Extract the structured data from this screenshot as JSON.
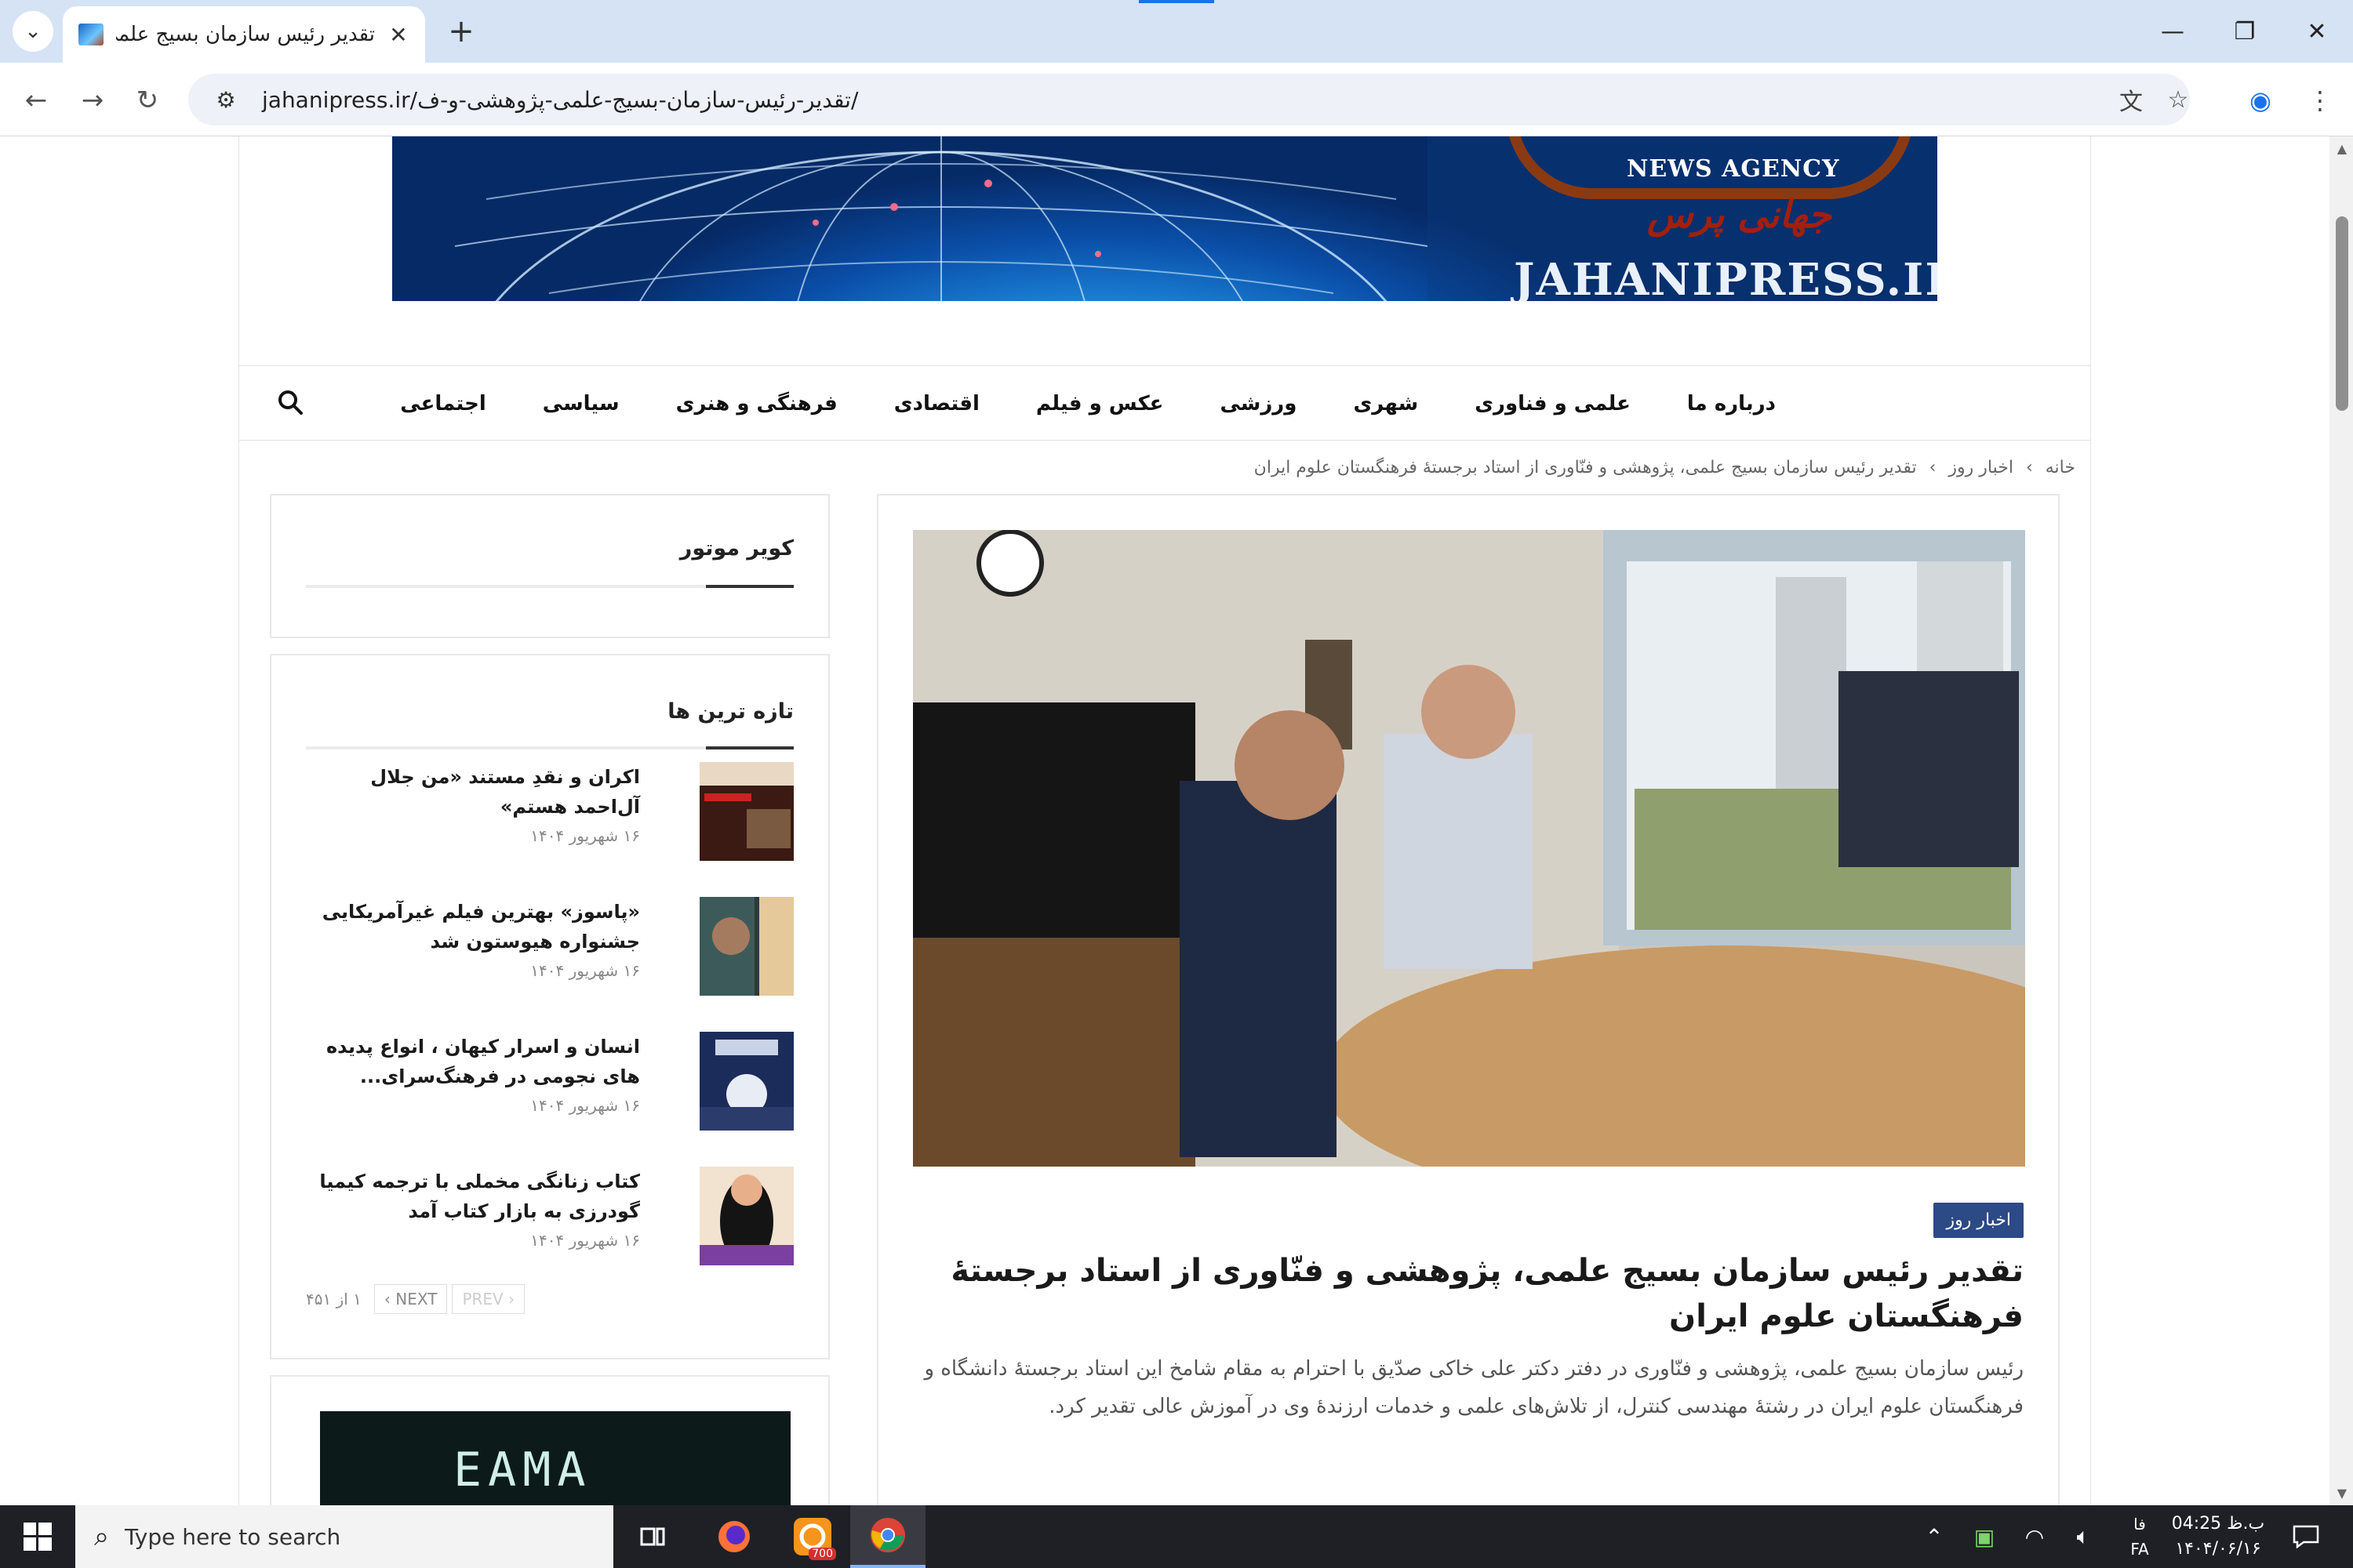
{
  "browser": {
    "tab_title": "تقدیر رئیس سازمان بسیج علمی، پ",
    "new_tab_label": "+",
    "tab_close_label": "✕",
    "url": "jahanipress.ir/تقدیر-رئیس-سازمان-بسیج-علمی-پژوهشی-و-ف/",
    "icons": [
      "tab-search-icon",
      "back-icon",
      "forward-icon",
      "reload-icon",
      "site-info-icon",
      "translate-icon",
      "bookmark-star-icon",
      "profile-icon",
      "menu-dots-icon",
      "minimize-icon",
      "maximize-icon",
      "close-icon"
    ]
  },
  "banner": {
    "news_label": "NEWS  AGENCY",
    "site_label": "JAHANIPRESS.IR",
    "persian_logo": "جهانی پرس"
  },
  "menu": {
    "items": [
      "اجتماعی",
      "سیاسی",
      "فرهنگی و هنری",
      "اقتصادی",
      "عکس و فیلم",
      "ورزشی",
      "شهری",
      "علمی و فناوری",
      "درباره ما"
    ]
  },
  "breadcrumb": {
    "home": "خانه",
    "separator": "›",
    "category": "اخبار روز",
    "current": "تقدیر رئیس سازمان بسیج علمی، پژوهشی و فنّاوری از استاد برجستهٔ فرهنگستان علوم ایران"
  },
  "article": {
    "category_tag": "اخبار روز",
    "title": "تقدیر رئیس سازمان بسیج علمی، پژوهشی و فنّاوری از استاد برجستهٔ فرهنگستان علوم ایران",
    "lead": "رئیس سازمان بسیج علمی، پژوهشی و فنّاوری در دفتر دکتر علی خاکی صدّیق با احترام به مقام شامخ این استاد برجستهٔ دانشگاه و  فرهنگستان علوم ایران در رشتهٔ مهندسی کنترل، از تلاش‌های علمی و خدمات  ارزندهٔ وی در آموزش عالی تقدیر کرد."
  },
  "sidebar": {
    "widget1_title": "کویر موتور",
    "widget2_title": "تازه ترین ها",
    "posts": [
      {
        "title": "اکران و نقدِ مستند «من جلال آل‌احمد هستم»",
        "date": "۱۶ شهریور ۱۴۰۴"
      },
      {
        "title": "«پاسوز» بهترین فیلم غیرآمریکایی جشنواره هیوستون شد",
        "date": "۱۶ شهریور ۱۴۰۴"
      },
      {
        "title": "انسان و اسرار کیهان ، انواع پدیده های نجومی در فرهنگ‌سرای...",
        "date": "۱۶ شهریور ۱۴۰۴"
      },
      {
        "title": "کتاب زنانگی مخملی با ترجمه کیمیا گودرزی به بازار کتاب آمد",
        "date": "۱۶ شهریور ۱۴۰۴"
      }
    ],
    "pager": {
      "prev": "PREV",
      "next": "NEXT",
      "count": "۱ از ۴۵۱"
    },
    "ad_text": "EAMA"
  },
  "taskbar": {
    "search_placeholder": "Type here to search",
    "clock_time": "ب.ظ 04:25",
    "clock_date": "۱۴۰۴/۰۶/۱۶",
    "lang_top": "فا",
    "lang_bottom": "FA",
    "badge_count": "700"
  }
}
